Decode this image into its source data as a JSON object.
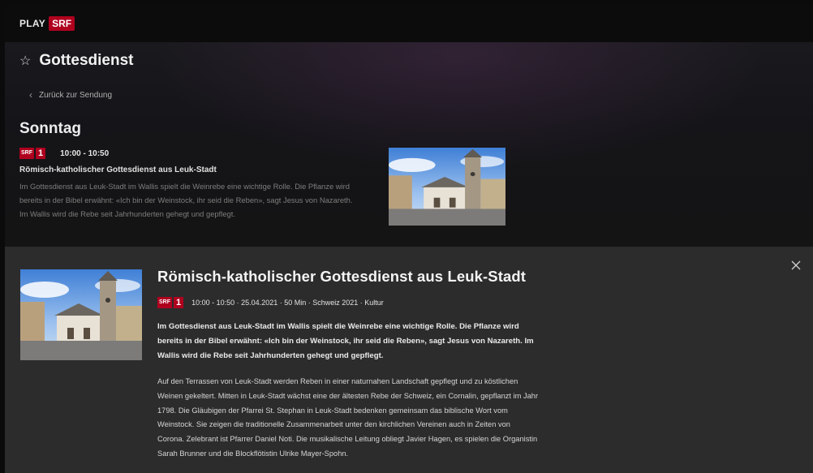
{
  "brand": {
    "play": "PLAY",
    "srf": "SRF"
  },
  "show": {
    "title": "Gottesdienst",
    "back_label": "Zurück zur Sendung"
  },
  "schedule": {
    "day": "Sonntag",
    "channel_logo": {
      "text": "SRF",
      "number": "1"
    },
    "time": "10:00 - 10:50",
    "title": "Römisch-katholischer Gottesdienst aus Leuk-Stadt",
    "description": "Im Gottesdienst aus Leuk-Stadt im Wallis spielt die Weinrebe eine wichtige Rolle. Die Pflanze wird bereits in der Bibel erwähnt: «Ich bin der Weinstock, ihr seid die Reben», sagt Jesus von Nazareth. Im Wallis wird die Rebe seit Jahrhunderten gehegt und gepflegt."
  },
  "detail": {
    "title": "Römisch-katholischer Gottesdienst aus Leuk-Stadt",
    "meta": "10:00 - 10:50 · 25.04.2021 · 50 Min · Schweiz 2021 · Kultur",
    "lead": "Im Gottesdienst aus Leuk-Stadt im Wallis spielt die Weinrebe eine wichtige Rolle. Die Pflanze wird bereits in der Bibel erwähnt: «Ich bin der Weinstock, ihr seid die Reben», sagt Jesus von Nazareth. Im Wallis wird die Rebe seit Jahrhunderten gehegt und gepflegt.",
    "body": "Auf den Terrassen von Leuk-Stadt werden Reben in einer naturnahen Landschaft gepflegt und zu köstlichen Weinen gekeltert. Mitten in Leuk-Stadt wächst eine der ältesten Rebe der Schweiz, ein Cornalin, gepflanzt im Jahr 1798. Die Gläubigen der Pfarrei St. Stephan in Leuk-Stadt bedenken gemeinsam das biblische Wort vom Weinstock. Sie zeigen die traditionelle Zusammenarbeit unter den kirchlichen Vereinen auch in Zeiten von Corona. Zelebrant ist Pfarrer Daniel Noti. Die musikalische Leitung obliegt Javier Hagen, es spielen die Organistin Sarah Brunner und die Blockflötistin Ulrike Mayer-Spohn."
  },
  "colors": {
    "brand_red": "#af001e",
    "overlay_bg": "#2c2c2d",
    "page_bg": "#121212"
  },
  "icons": {
    "favorite": "star-outline-icon",
    "back": "chevron-left-icon",
    "close": "close-icon"
  }
}
